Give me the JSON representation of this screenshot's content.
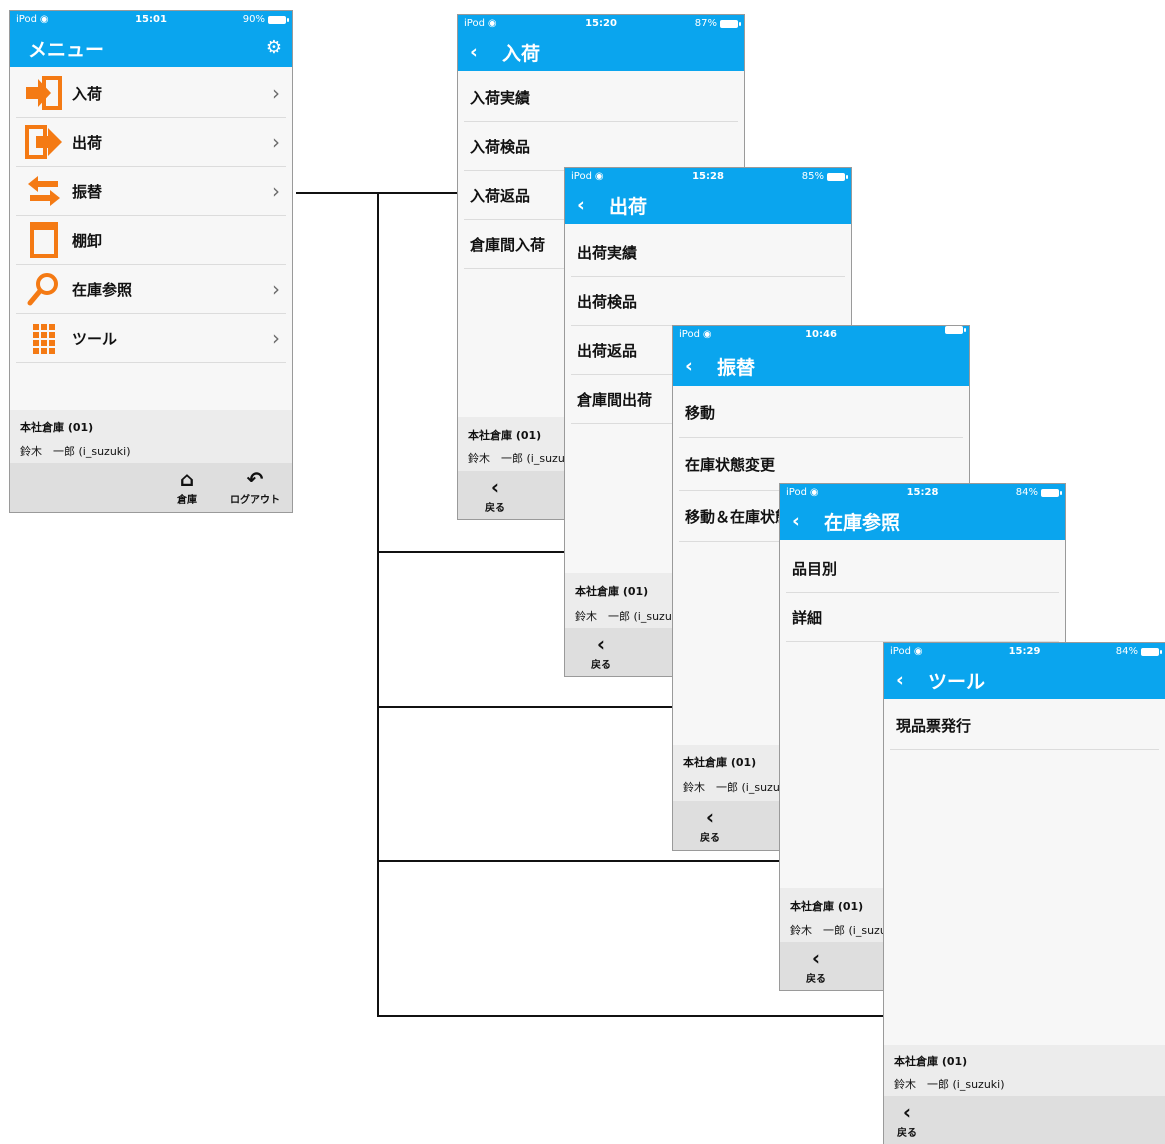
{
  "main": {
    "status": {
      "carrier": "iPod",
      "time": "15:01",
      "battery": "90%"
    },
    "title": "メニュー",
    "items": [
      {
        "label": "入荷",
        "icon": "arrival-icon"
      },
      {
        "label": "出荷",
        "icon": "shipping-icon"
      },
      {
        "label": "振替",
        "icon": "transfer-icon"
      },
      {
        "label": "棚卸",
        "icon": "inventory-icon"
      },
      {
        "label": "在庫参照",
        "icon": "search-icon"
      },
      {
        "label": "ツール",
        "icon": "tools-grid-icon"
      }
    ],
    "warehouse": "本社倉庫 (01)",
    "user": "鈴木　一郎 (i_suzuki)",
    "tab_warehouse": "倉庫",
    "tab_logout": "ログアウト"
  },
  "arrival": {
    "status": {
      "carrier": "iPod",
      "time": "15:20",
      "battery": "87%"
    },
    "title": "入荷",
    "items": [
      "入荷実績",
      "入荷検品",
      "入荷返品",
      "倉庫間入荷"
    ],
    "warehouse": "本社倉庫 (01)",
    "user": "鈴木　一郎 (i_suzuki)",
    "back": "戻る"
  },
  "shipping": {
    "status": {
      "carrier": "iPod",
      "time": "15:28",
      "battery": "85%"
    },
    "title": "出荷",
    "items": [
      "出荷実績",
      "出荷検品",
      "出荷返品",
      "倉庫間出荷"
    ],
    "warehouse": "本社倉庫 (01)",
    "user": "鈴木　一郎 (i_suzuki)",
    "back": "戻る"
  },
  "transfer": {
    "status": {
      "carrier": "iPod",
      "time": "10:46",
      "battery": ""
    },
    "title": "振替",
    "items": [
      "移動",
      "在庫状態変更",
      "移動＆在庫状態変更"
    ],
    "warehouse": "本社倉庫 (01)",
    "user": "鈴木　一郎 (i_suzuki)",
    "back": "戻る"
  },
  "stock": {
    "status": {
      "carrier": "iPod",
      "time": "15:28",
      "battery": "84%"
    },
    "title": "在庫参照",
    "items": [
      "品目別",
      "詳細"
    ],
    "warehouse": "本社倉庫 (01)",
    "user": "鈴木　一郎 (i_suzuki)",
    "back": "戻る"
  },
  "tools": {
    "status": {
      "carrier": "iPod",
      "time": "15:29",
      "battery": "84%"
    },
    "title": "ツール",
    "items": [
      "現品票発行"
    ],
    "warehouse": "本社倉庫 (01)",
    "user": "鈴木　一郎 (i_suzuki)",
    "back": "戻る"
  },
  "colors": {
    "header": "#0aa5ee",
    "icon_orange": "#f47a14",
    "background": "#f7f7f7"
  }
}
